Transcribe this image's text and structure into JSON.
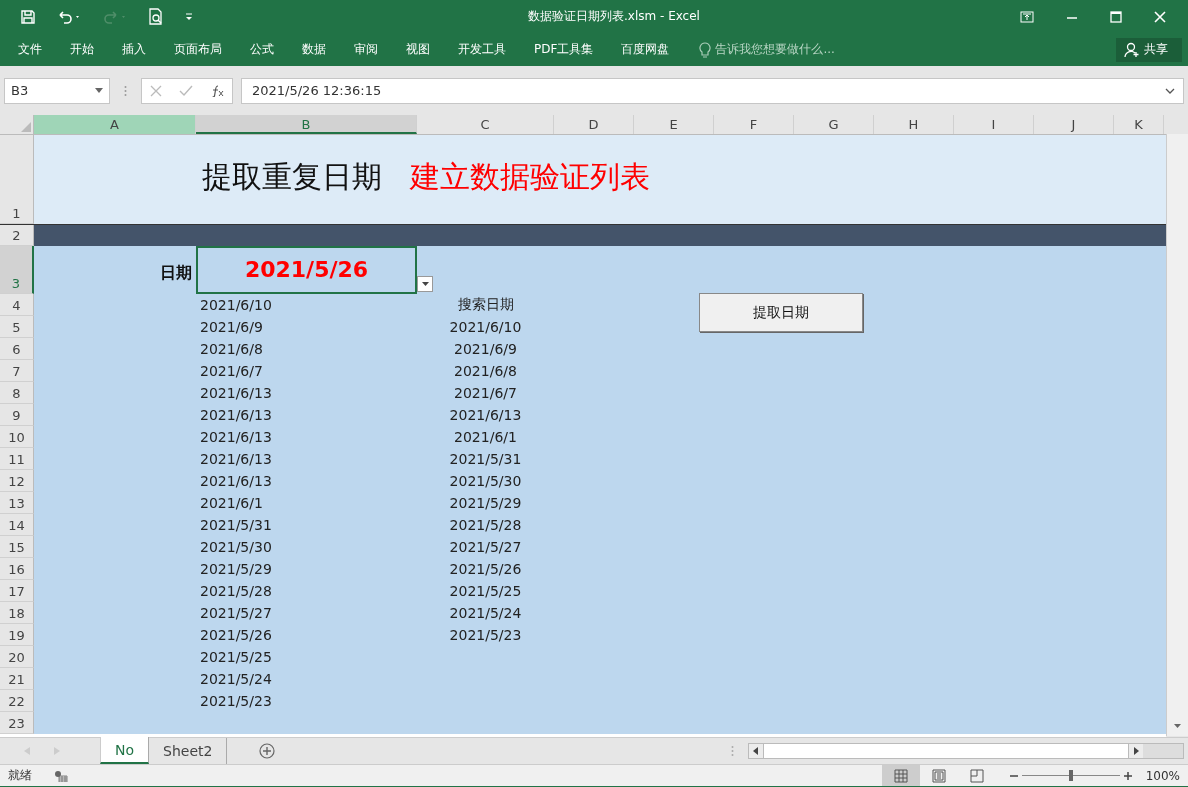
{
  "window": {
    "title": "数据验证日期列表.xlsm - Excel"
  },
  "ribbon": {
    "tabs": [
      {
        "label": "文件"
      },
      {
        "label": "开始"
      },
      {
        "label": "插入"
      },
      {
        "label": "页面布局"
      },
      {
        "label": "公式"
      },
      {
        "label": "数据"
      },
      {
        "label": "审阅"
      },
      {
        "label": "视图"
      },
      {
        "label": "开发工具"
      },
      {
        "label": "PDF工具集"
      },
      {
        "label": "百度网盘"
      }
    ],
    "tell_me": "告诉我您想要做什么...",
    "share": "共享"
  },
  "formula_bar": {
    "name_box": "B3",
    "value": "2021/5/26  12:36:15"
  },
  "columns": [
    {
      "label": "A",
      "selected": false,
      "highlighted": true
    },
    {
      "label": "B",
      "selected": true,
      "highlighted": false
    },
    {
      "label": "C",
      "selected": false,
      "highlighted": false
    },
    {
      "label": "D",
      "selected": false,
      "highlighted": false
    },
    {
      "label": "E",
      "selected": false,
      "highlighted": false
    },
    {
      "label": "F",
      "selected": false,
      "highlighted": false
    },
    {
      "label": "G",
      "selected": false,
      "highlighted": false
    },
    {
      "label": "H",
      "selected": false,
      "highlighted": false
    },
    {
      "label": "I",
      "selected": false,
      "highlighted": false
    },
    {
      "label": "J",
      "selected": false,
      "highlighted": false
    },
    {
      "label": "K",
      "selected": false,
      "highlighted": false
    }
  ],
  "rows": [
    {
      "number": "1",
      "kind": "title",
      "selected": false,
      "title": "提取重复日期",
      "subtitle": "建立数据验证列表"
    },
    {
      "number": "2",
      "kind": "band",
      "selected": false
    },
    {
      "number": "3",
      "kind": "input",
      "selected": true,
      "label": "日期",
      "value": "2021/5/26"
    },
    {
      "number": "4",
      "kind": "data",
      "selected": false,
      "b": "2021/6/10",
      "c": "搜索日期"
    },
    {
      "number": "5",
      "kind": "data",
      "selected": false,
      "b": "2021/6/9",
      "c": "2021/6/10"
    },
    {
      "number": "6",
      "kind": "data",
      "selected": false,
      "b": "2021/6/8",
      "c": "2021/6/9"
    },
    {
      "number": "7",
      "kind": "data",
      "selected": false,
      "b": "2021/6/7",
      "c": "2021/6/8"
    },
    {
      "number": "8",
      "kind": "data",
      "selected": false,
      "b": "2021/6/13",
      "c": "2021/6/7"
    },
    {
      "number": "9",
      "kind": "data",
      "selected": false,
      "b": "2021/6/13",
      "c": "2021/6/13"
    },
    {
      "number": "10",
      "kind": "data",
      "selected": false,
      "b": "2021/6/13",
      "c": "2021/6/1"
    },
    {
      "number": "11",
      "kind": "data",
      "selected": false,
      "b": "2021/6/13",
      "c": "2021/5/31"
    },
    {
      "number": "12",
      "kind": "data",
      "selected": false,
      "b": "2021/6/13",
      "c": "2021/5/30"
    },
    {
      "number": "13",
      "kind": "data",
      "selected": false,
      "b": "2021/6/1",
      "c": "2021/5/29"
    },
    {
      "number": "14",
      "kind": "data",
      "selected": false,
      "b": "2021/5/31",
      "c": "2021/5/28"
    },
    {
      "number": "15",
      "kind": "data",
      "selected": false,
      "b": "2021/5/30",
      "c": "2021/5/27"
    },
    {
      "number": "16",
      "kind": "data",
      "selected": false,
      "b": "2021/5/29",
      "c": "2021/5/26"
    },
    {
      "number": "17",
      "kind": "data",
      "selected": false,
      "b": "2021/5/28",
      "c": "2021/5/25"
    },
    {
      "number": "18",
      "kind": "data",
      "selected": false,
      "b": "2021/5/27",
      "c": "2021/5/24"
    },
    {
      "number": "19",
      "kind": "data",
      "selected": false,
      "b": "2021/5/26",
      "c": "2021/5/23"
    },
    {
      "number": "20",
      "kind": "data",
      "selected": false,
      "b": "2021/5/25"
    },
    {
      "number": "21",
      "kind": "data",
      "selected": false,
      "b": "2021/5/24"
    },
    {
      "number": "22",
      "kind": "data",
      "selected": false,
      "b": "2021/5/23"
    },
    {
      "number": "23",
      "kind": "data",
      "selected": false
    }
  ],
  "sheet_button": "提取日期",
  "sheet_tabs": [
    {
      "label": "No",
      "selected": true
    },
    {
      "label": "Sheet2",
      "selected": false
    }
  ],
  "status_bar": {
    "status": "就绪",
    "zoom": "100%",
    "zoom_slider": {
      "level": 0.5
    }
  }
}
